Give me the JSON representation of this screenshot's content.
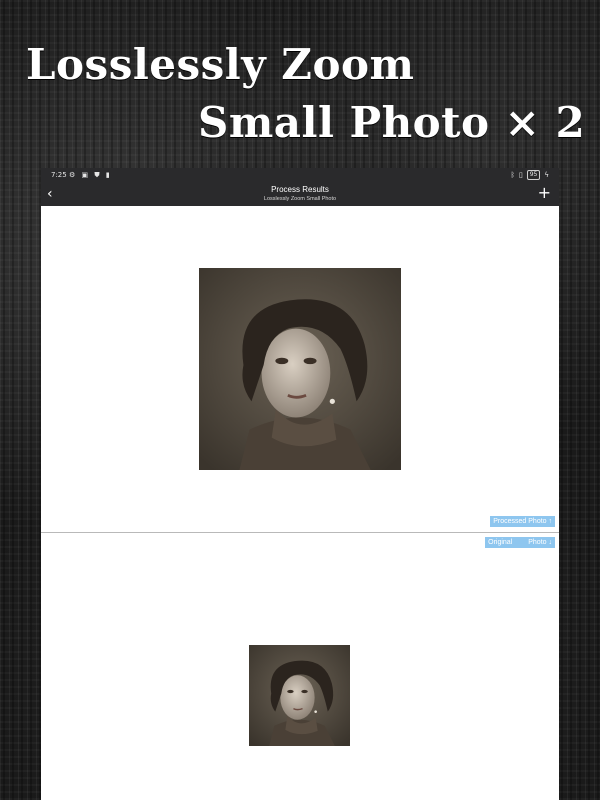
{
  "headline": {
    "line1": "Losslessly Zoom",
    "line2": "Small Photo × 2"
  },
  "status_bar": {
    "time": "7:25",
    "left_icons": [
      "settings-icon",
      "app-icon",
      "shield-icon",
      "sd-card-icon"
    ],
    "battery": "95",
    "right_icons": [
      "bluetooth-icon",
      "vibrate-icon",
      "battery-icon",
      "charging-icon"
    ]
  },
  "nav": {
    "title": "Process Results",
    "subtitle": "Losslessly Zoom Small Photo",
    "back_icon": "chevron-left-icon",
    "add_icon": "plus-icon"
  },
  "labels": {
    "processed_photo": "Processed Photo ↑",
    "original_word": "Original",
    "original_photo": "Photo ↓"
  },
  "colors": {
    "bar_background": "#2a2a2c",
    "chip_background": "#8ec6ef",
    "page_background": "#1a1a1a"
  }
}
